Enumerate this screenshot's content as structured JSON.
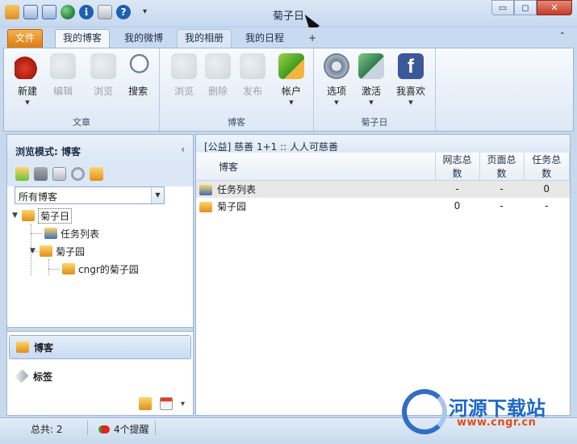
{
  "window": {
    "title": "菊子日",
    "minimize_icon": "▭",
    "restore_icon": "◻",
    "close_icon": "✕"
  },
  "quick_access": [
    {
      "icon": "folder-open-icon",
      "color": "#e8a23a"
    },
    {
      "icon": "back-icon",
      "color": "#3a6fb5"
    },
    {
      "icon": "up-icon",
      "color": "#3a6fb5"
    },
    {
      "icon": "globe-icon",
      "color": "#2e8b3e"
    },
    {
      "icon": "info-icon",
      "color": "#1f5fb0"
    },
    {
      "icon": "mail-icon",
      "color": "#8a8f99"
    },
    {
      "icon": "help-icon",
      "color": "#1f5fb0"
    }
  ],
  "qat_customize": "▾",
  "tabs": {
    "file": "文件",
    "items": [
      "我的博客",
      "我的微博",
      "我的相册",
      "我的日程"
    ],
    "active": "我的博客",
    "plus": "+",
    "collapse": "⌃"
  },
  "ribbon": {
    "groups": [
      {
        "label": "文章",
        "buttons": [
          {
            "label": "新建",
            "icon": "new-article-icon",
            "enabled": true,
            "caret": true
          },
          {
            "label": "编辑",
            "icon": "edit-icon",
            "enabled": false,
            "caret": false
          },
          {
            "label": "浏览",
            "icon": "browse-icon",
            "enabled": false,
            "caret": false
          },
          {
            "label": "搜索",
            "icon": "search-icon",
            "enabled": true,
            "caret": false
          }
        ]
      },
      {
        "label": "博客",
        "buttons": [
          {
            "label": "浏览",
            "icon": "browse-blog-icon",
            "enabled": false,
            "caret": false
          },
          {
            "label": "删除",
            "icon": "delete-icon",
            "enabled": false,
            "caret": false
          },
          {
            "label": "发布",
            "icon": "publish-icon",
            "enabled": false,
            "caret": false
          },
          {
            "label": "帐户",
            "icon": "account-icon",
            "enabled": true,
            "caret": true
          }
        ]
      },
      {
        "label": "菊子日",
        "buttons": [
          {
            "label": "选项",
            "icon": "options-gear-icon",
            "enabled": true,
            "caret": true
          },
          {
            "label": "激活",
            "icon": "activate-icon",
            "enabled": true,
            "caret": true
          },
          {
            "label": "我喜欢",
            "icon": "facebook-icon",
            "enabled": true,
            "caret": true
          }
        ]
      }
    ]
  },
  "left_panel": {
    "title": "浏览模式: 博客",
    "collapse": "‹",
    "select_value": "所有博客",
    "tree": {
      "root": "菊子日",
      "children": [
        "任务列表",
        "菊子园"
      ],
      "grandchild": "cngr的菊子园"
    },
    "nav": {
      "blog": "博客",
      "tags": "标签"
    },
    "bottom_caret": "▾"
  },
  "right_panel": {
    "header": "[公益] 慈善 1+1 :: 人人可慈善",
    "columns": [
      "博客",
      "网志总数",
      "页面总数",
      "任务总数"
    ],
    "rows": [
      {
        "name": "任务列表",
        "posts": "-",
        "pages": "-",
        "tasks": "0"
      },
      {
        "name": "菊子园",
        "posts": "0",
        "pages": "-",
        "tasks": "-"
      }
    ]
  },
  "status": {
    "total": "总共: 2",
    "reminders": "4个提醒"
  },
  "watermark": {
    "name": "河源下载站",
    "url": "www.cngr.cn"
  }
}
